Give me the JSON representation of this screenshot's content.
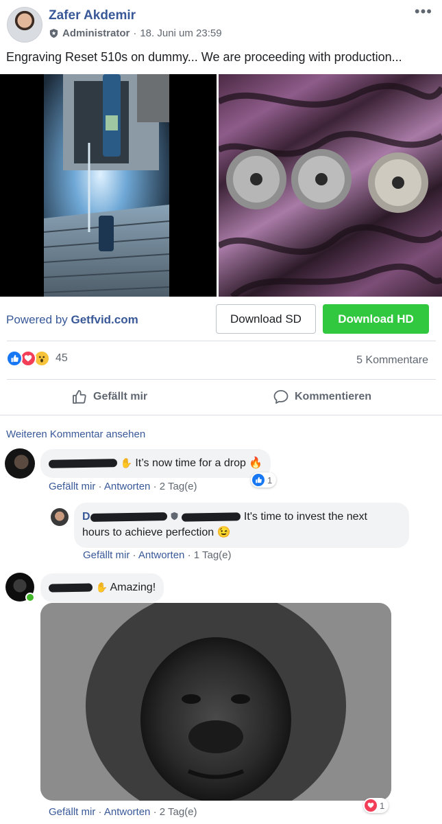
{
  "post": {
    "author": "Zafer Akdemir",
    "role": "Administrator",
    "separator": "·",
    "timestamp": "18. Juni um 23:59",
    "more_label": "•••",
    "text": "Engraving Reset 510s on dummy... We are proceeding with production..."
  },
  "download": {
    "powered_prefix": "Powered by ",
    "powered_brand": "Getfvid.com",
    "sd_label": "Download SD",
    "hd_label": "Download HD",
    "hd_color": "#31c840"
  },
  "stats": {
    "reaction_icons": [
      "like-icon",
      "love-icon",
      "wow-icon"
    ],
    "reaction_count": "45",
    "comments_label": "5 Kommentare"
  },
  "actions": {
    "like_label": "Gefällt mir",
    "comment_label": "Kommentieren"
  },
  "comments_section": {
    "more_label": "Weiteren Kommentar ansehen",
    "c1": {
      "text": "It’s now time for a drop 🔥",
      "reaction_count": "1",
      "like": "Gefällt mir",
      "reply": "Antworten",
      "time": "2 Tag(e)"
    },
    "reply1": {
      "text": "It's time to invest the next",
      "text2": "hours to achieve perfection 😉",
      "like": "Gefällt mir",
      "reply": "Antworten",
      "time": "1 Tag(e)"
    },
    "c2": {
      "text": "Amazing!",
      "reaction_count": "1",
      "like": "Gefällt mir",
      "reply": "Antworten",
      "time": "2 Tag(e)"
    }
  },
  "colors": {
    "link_blue": "#385898",
    "secondary_text": "#606770",
    "bubble_bg": "#f2f3f5"
  }
}
